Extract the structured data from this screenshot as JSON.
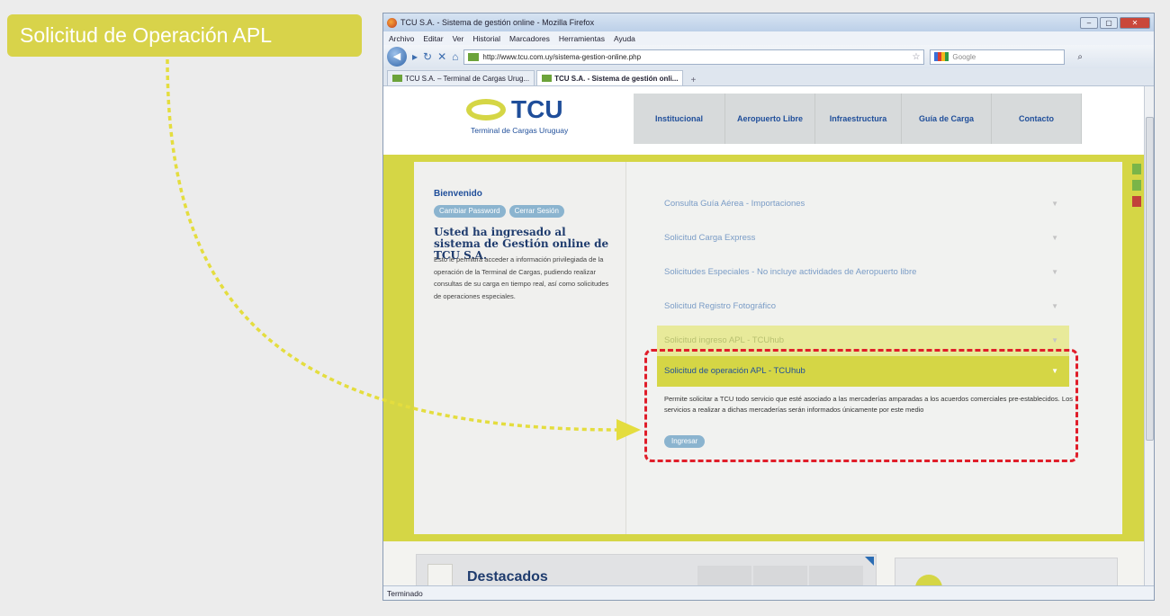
{
  "callout": {
    "label": "Solicitud de Operación APL",
    "color": "#d8d34a"
  },
  "browser": {
    "title": "TCU S.A. - Sistema de gestión online - Mozilla Firefox",
    "window_buttons": [
      "–",
      "▢",
      "✕"
    ],
    "menu": [
      "Archivo",
      "Editar",
      "Ver",
      "Historial",
      "Marcadores",
      "Herramientas",
      "Ayuda"
    ],
    "url": "http://www.tcu.com.uy/sistema-gestion-online.php",
    "search_placeholder": "Google",
    "tabs": [
      {
        "label": "TCU S.A. – Terminal de Cargas Urug...",
        "active": false
      },
      {
        "label": "TCU S.A. - Sistema de gestión onli...",
        "active": true
      }
    ],
    "status": "Terminado"
  },
  "site": {
    "logo_text": "TCU",
    "logo_sub": "Terminal de Cargas Uruguay",
    "nav": [
      "Institucional",
      "Aeropuerto Libre",
      "Infraestructura",
      "Guía de Carga",
      "Contacto"
    ],
    "accent": "#d5d645",
    "brand_blue": "#1f4e9a"
  },
  "left": {
    "welcome": "Bienvenido",
    "buttons": [
      "Cambiar Password",
      "Cerrar Sesión"
    ],
    "intro_title": "Usted ha ingresado al sistema de Gestión online de TCU S.A.",
    "intro_body": "Esto le permitirá acceder a información privilegiada de la operación de la Terminal de Cargas, pudiendo realizar consultas de su carga en tiempo real, así como solicitudes de operaciones especiales."
  },
  "accordion": {
    "items": [
      "Consulta Guía Aérea - Importaciones",
      "Solicitud Carga Express",
      "Solicitudes Especiales - No incluye actividades de Aeropuerto libre",
      "Solicitud Registro Fotográfico",
      "Solicitud ingreso APL - TCUhub"
    ],
    "active": {
      "title": "Solicitud de operación APL - TCUhub",
      "description": "Permite solicitar a TCU todo servicio que esté asociado a las mercaderías amparadas a los acuerdos comerciales pre-establecidos. Los servicios a realizar a dichas mercaderías serán informados únicamente por este medio",
      "button": "Ingresar"
    }
  },
  "bottom": {
    "destacados": "Destacados"
  }
}
